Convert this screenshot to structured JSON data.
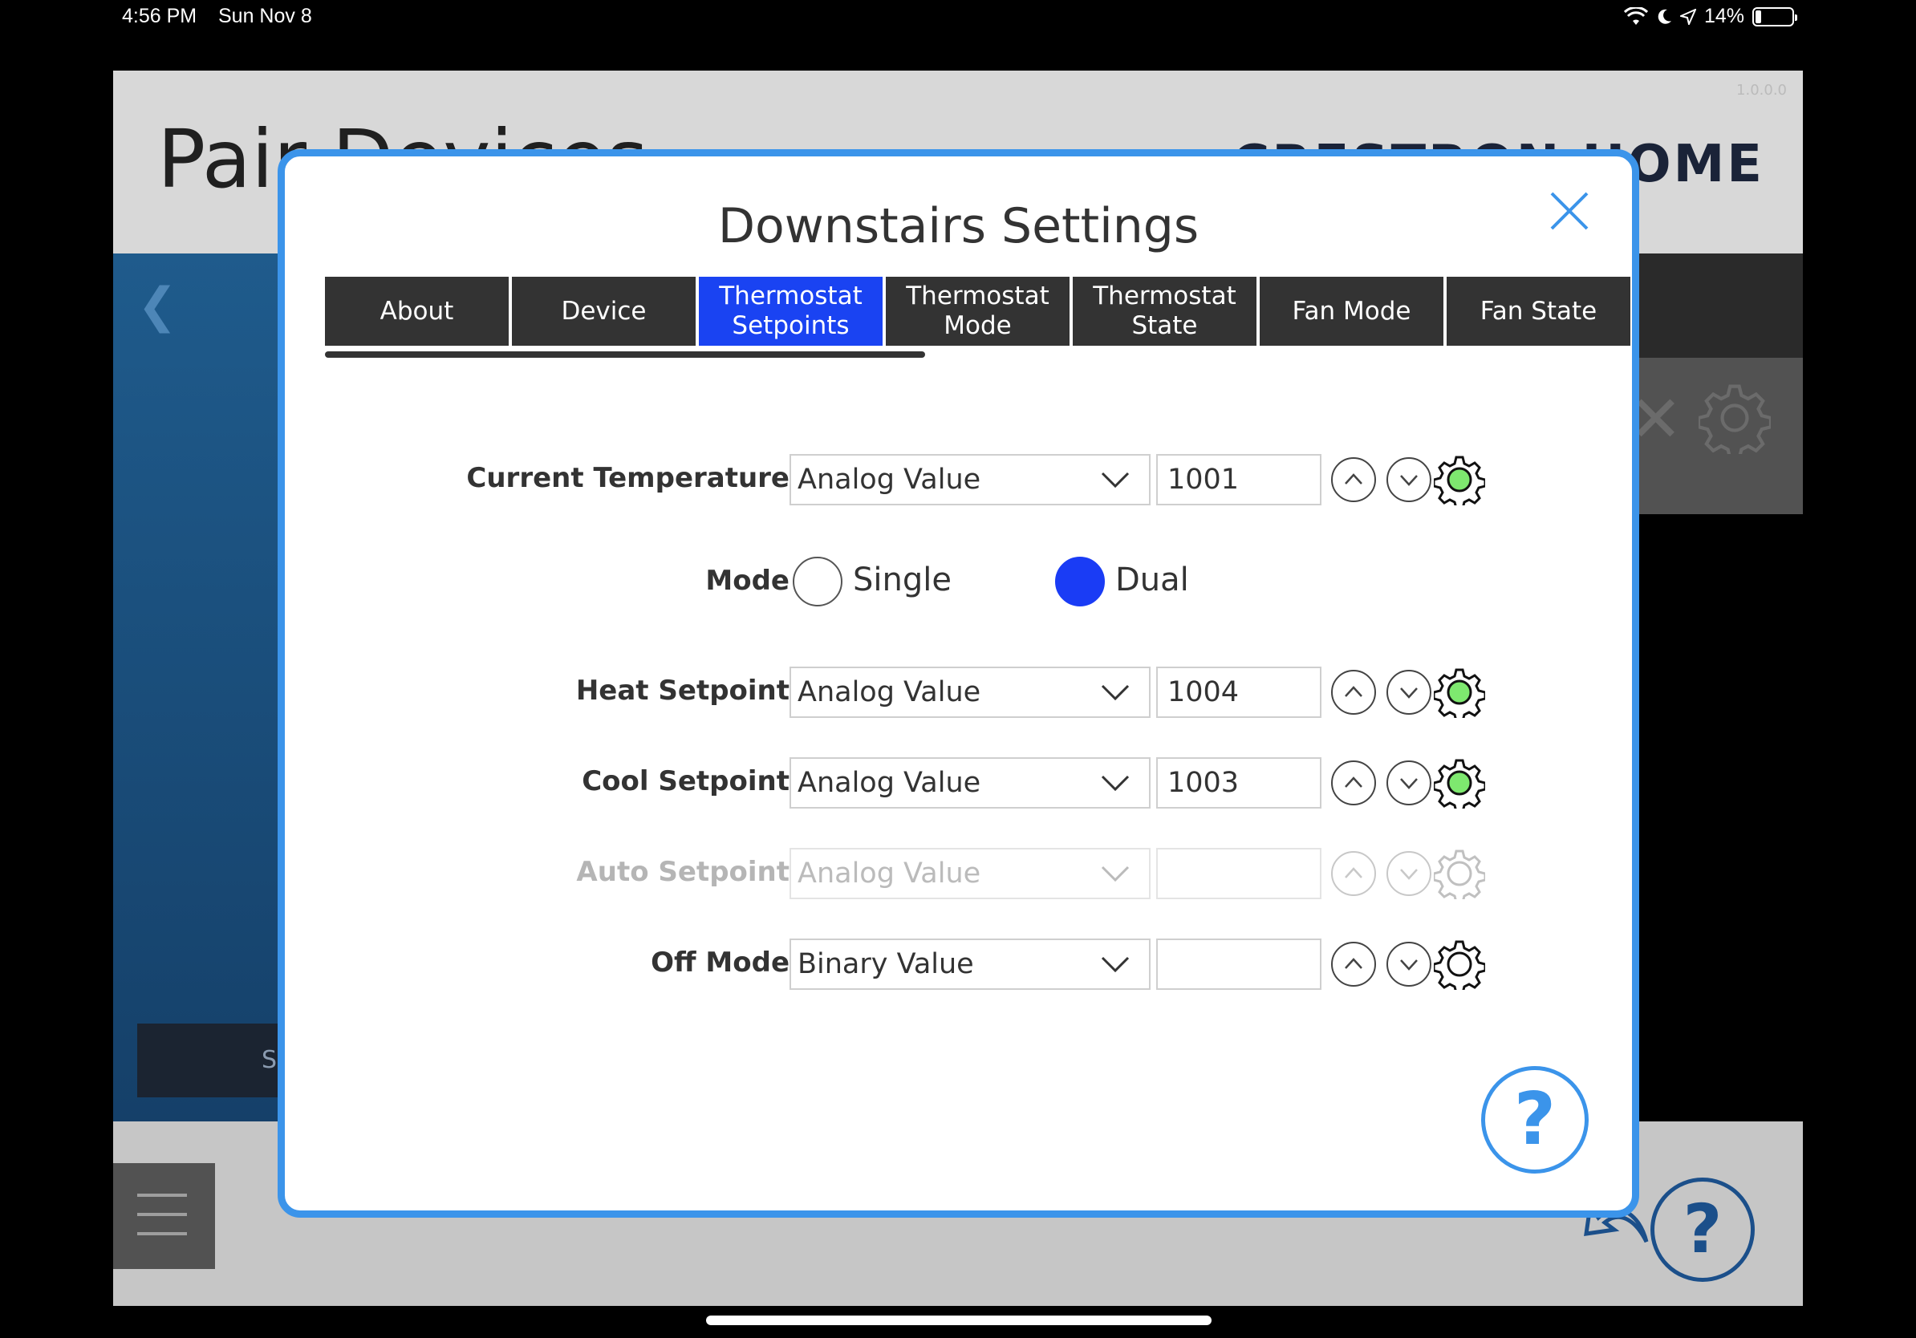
{
  "status_bar": {
    "time": "4:56 PM",
    "date": "Sun Nov 8",
    "battery": "14%"
  },
  "app": {
    "title": "Pair Devices",
    "brand": "CRESTRON HOME",
    "version": "1.0.0.0",
    "left_button": "Save"
  },
  "modal": {
    "title": "Downstairs Settings",
    "tabs": [
      {
        "label": "About",
        "active": false
      },
      {
        "label": "Device",
        "active": false
      },
      {
        "label": "Thermostat\nSetpoints",
        "active": true
      },
      {
        "label": "Thermostat\nMode",
        "active": false
      },
      {
        "label": "Thermostat\nState",
        "active": false
      },
      {
        "label": "Fan Mode",
        "active": false
      },
      {
        "label": "Fan State",
        "active": false
      }
    ],
    "rows": {
      "current_temperature": {
        "label": "Current Temperature",
        "type": "Analog Value",
        "value": "1001",
        "status_color": "#7ee86f"
      },
      "heat_setpoint": {
        "label": "Heat Setpoint",
        "type": "Analog Value",
        "value": "1004",
        "status_color": "#7ee86f"
      },
      "cool_setpoint": {
        "label": "Cool Setpoint",
        "type": "Analog Value",
        "value": "1003",
        "status_color": "#7ee86f"
      },
      "auto_setpoint": {
        "label": "Auto Setpoint",
        "type": "Analog Value",
        "value": "",
        "disabled": true
      },
      "off_mode": {
        "label": "Off Mode",
        "type": "Binary Value",
        "value": ""
      }
    },
    "mode": {
      "label": "Mode",
      "options": [
        {
          "label": "Single",
          "selected": false
        },
        {
          "label": "Dual",
          "selected": true
        }
      ]
    },
    "help": "?"
  },
  "colors": {
    "accent": "#3b94ea",
    "active_tab": "#1a43f2",
    "radio_selected": "#1a3cf5",
    "tab_bg": "#333333"
  }
}
